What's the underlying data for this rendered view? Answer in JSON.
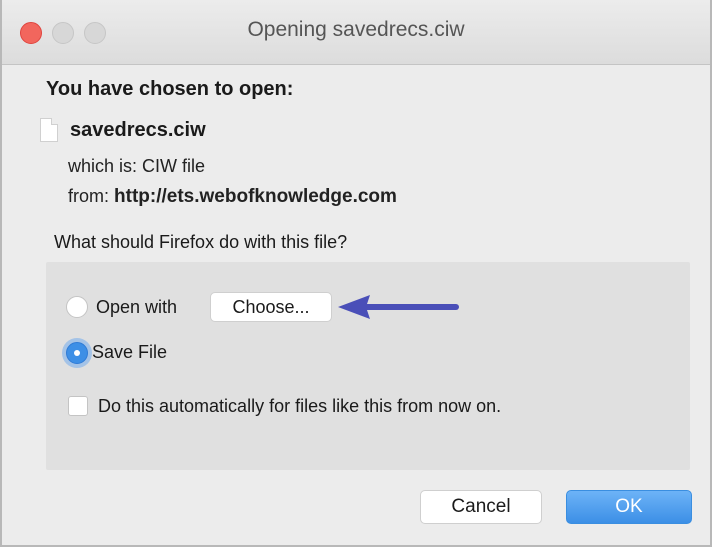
{
  "window": {
    "title": "Opening savedrecs.ciw"
  },
  "dialog": {
    "heading": "You have chosen to open:",
    "filename": "savedrecs.ciw",
    "which_label": "which is:",
    "which_value": "CIW file",
    "from_label": "from:",
    "from_value": "http://ets.webofknowledge.com",
    "question": "What should Firefox do with this file?"
  },
  "options": {
    "open_with_label": "Open with",
    "open_with_selected": false,
    "choose_label": "Choose...",
    "save_file_label": "Save File",
    "save_file_selected": true,
    "auto_label": "Do this automatically for files like this from now on.",
    "auto_checked": false
  },
  "buttons": {
    "cancel": "Cancel",
    "ok": "OK"
  },
  "colors": {
    "accent": "#3d8fe6",
    "arrow": "#4a4fb8",
    "close": "#f2665d"
  },
  "icons": [
    "close-window-icon",
    "minimize-window-icon",
    "maximize-window-icon",
    "document-icon",
    "arrow-left-icon"
  ]
}
